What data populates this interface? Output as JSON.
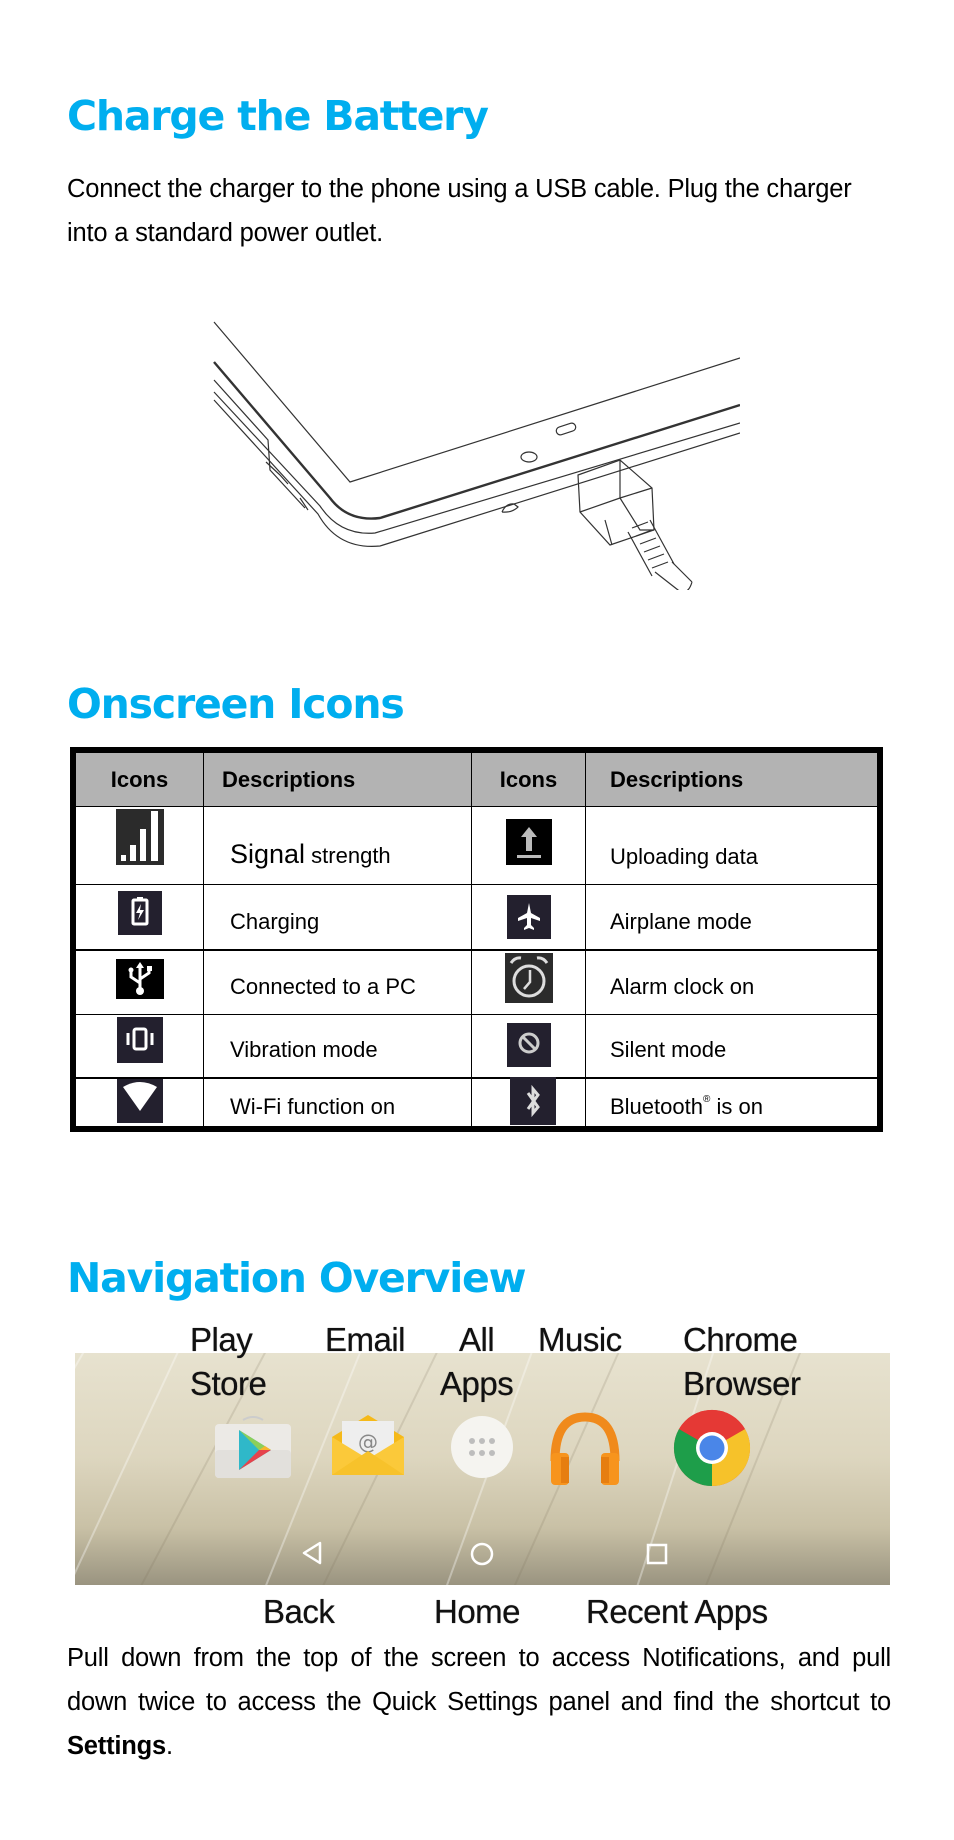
{
  "sections": {
    "charge": {
      "title": "Charge the Battery",
      "body": "Connect the charger to the phone using a USB cable. Plug the charger into a standard power outlet.",
      "illustration": "tablet-usb-charger-illustration"
    },
    "icons": {
      "title": "Onscreen Icons",
      "table": {
        "headers": [
          "Icons",
          "Descriptions",
          "Icons",
          "Descriptions"
        ],
        "rows": [
          {
            "left_icon": "signal-strength-icon",
            "left_desc_big": "Signal",
            "left_desc": " strength",
            "right_icon": "upload-icon",
            "right_desc": "Uploading data"
          },
          {
            "left_icon": "battery-charging-icon",
            "left_desc": "Charging",
            "right_icon": "airplane-icon",
            "right_desc": "Airplane mode"
          },
          {
            "left_icon": "usb-icon",
            "left_desc": "Connected to a PC",
            "right_icon": "alarm-clock-icon",
            "right_desc": "Alarm clock on"
          },
          {
            "left_icon": "vibration-icon",
            "left_desc": "Vibration mode",
            "right_icon": "silent-icon",
            "right_desc": "Silent mode"
          },
          {
            "left_icon": "wifi-icon",
            "left_desc": "Wi-Fi function on",
            "right_icon": "bluetooth-icon",
            "right_desc": "Bluetooth",
            "right_desc_sup": "®",
            "right_desc_tail": " is on"
          }
        ]
      }
    },
    "navigation": {
      "title": "Navigation Overview",
      "app_labels": [
        {
          "line1": "Play",
          "line2": "Store"
        },
        {
          "line1": "Email",
          "line2": ""
        },
        {
          "line1": "All",
          "line2": "Apps"
        },
        {
          "line1": "Music",
          "line2": ""
        },
        {
          "line1": "Chrome",
          "line2": "Browser"
        }
      ],
      "nav_labels": [
        "Back",
        "Home",
        "Recent Apps"
      ],
      "body_pre": "Pull down from the top of the screen to access Notifications, and pull down twice to access the Quick Settings panel and find the shortcut to ",
      "body_bold": "Settings",
      "body_post": "."
    }
  },
  "colors": {
    "heading": "#00aeef",
    "table_header_bg": "#b3b3b3",
    "icon_bg": "#23202e"
  }
}
